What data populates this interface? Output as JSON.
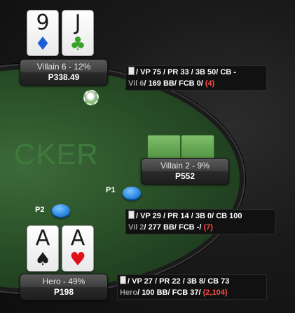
{
  "table": {
    "brand_text": "CKER"
  },
  "villain6": {
    "cards": [
      {
        "rank": "9",
        "suit": "♦",
        "suit_name": "diamonds",
        "color": "#1f5fd6"
      },
      {
        "rank": "J",
        "suit": "♣",
        "suit_name": "clubs",
        "color": "#3ba02a"
      }
    ],
    "name": "Villain 6 - 12%",
    "stack": "P338.49",
    "hud": {
      "line1": {
        "vp": "VP 75",
        "pr": "PR 33",
        "tb": "3B 50",
        "cb": "CB -"
      },
      "line2": {
        "who": "Vil 6",
        "bb": "169 BB",
        "fcb": "FCB 0",
        "hands": "(4)"
      }
    }
  },
  "villain2": {
    "name": "Villain 2 - 9%",
    "stack": "P552",
    "hud": {
      "line1": {
        "vp": "VP 29",
        "pr": "PR 14",
        "tb": "3B 0",
        "cb": "CB 100"
      },
      "line2": {
        "who": "Vil 2",
        "bb": "277 BB",
        "fcb": "FCB -",
        "hands": "(7)"
      }
    }
  },
  "hero": {
    "cards": [
      {
        "rank": "A",
        "suit": "♠",
        "suit_name": "spades",
        "color": "#1a1a1a"
      },
      {
        "rank": "A",
        "suit": "♥",
        "suit_name": "hearts",
        "color": "#e0111b"
      }
    ],
    "name": "Hero - 49%",
    "stack": "P198",
    "hud": {
      "line1": {
        "vp": "VP 27",
        "pr": "PR 22",
        "tb": "3B 8",
        "cb": "CB 73"
      },
      "line2": {
        "who": "Hero",
        "bb": "100 BB",
        "fcb": "FCB 37",
        "hands": "(2,104)"
      }
    }
  },
  "markers": {
    "p1": "P1",
    "p2": "P2"
  },
  "colors": {
    "felt": "#2a5028",
    "chip": "#2a88e0",
    "hud_red": "#ff4b4b"
  }
}
